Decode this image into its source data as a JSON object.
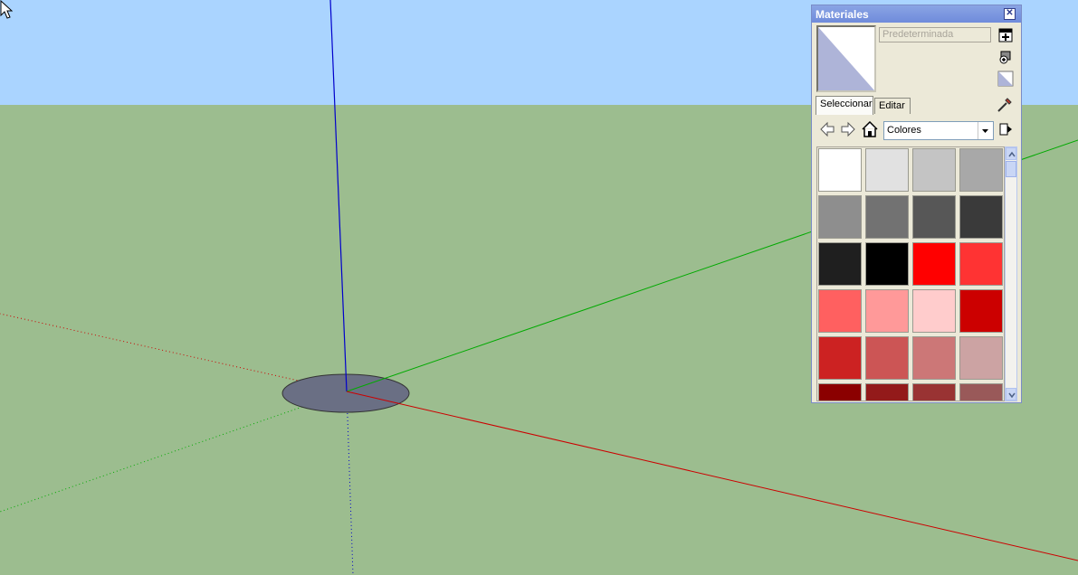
{
  "panel": {
    "title": "Materiales",
    "close_glyph": "✕",
    "material_name_placeholder": "Predeterminada",
    "tabs": [
      {
        "label": "Seleccionar",
        "active": true
      },
      {
        "label": "Editar",
        "active": false
      }
    ],
    "collection": "Colores",
    "icons": [
      "create-material-icon",
      "sample-paint-icon",
      "default-material-icon",
      "eyedropper-icon",
      "back-icon",
      "forward-icon",
      "home-icon",
      "details-icon",
      "scroll-up-icon",
      "scroll-down-icon",
      "chevron-down-icon"
    ],
    "swatches": [
      "#ffffff",
      "#e1e1e1",
      "#c4c4c4",
      "#a8a8a8",
      "#8e8e8e",
      "#727272",
      "#575757",
      "#3a3a3a",
      "#1f1f1f",
      "#000000",
      "#ff0000",
      "#ff3333",
      "#ff6060",
      "#ff9999",
      "#ffcccc",
      "#cc0000",
      "#cc2222",
      "#cc5555",
      "#cc7777",
      "#cca3a3",
      "#8b0000",
      "#931a1a",
      "#993333",
      "#995959"
    ]
  },
  "colors": {
    "sky": "#aad4ff",
    "ground": "#9cbd8f",
    "axis_blue": "#0000cc",
    "axis_green": "#00aa00",
    "axis_red": "#cc0000",
    "disc": "#6a6f84"
  }
}
